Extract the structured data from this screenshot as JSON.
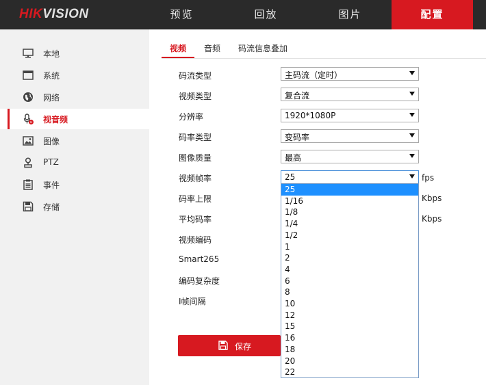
{
  "brand": {
    "logo_red": "HIK",
    "logo_rest": "VISION"
  },
  "nav": {
    "tabs": [
      {
        "label": "预览"
      },
      {
        "label": "回放"
      },
      {
        "label": "图片"
      },
      {
        "label": "配置",
        "active": true
      }
    ]
  },
  "sidebar": {
    "items": [
      {
        "label": "本地",
        "icon": "monitor-icon"
      },
      {
        "label": "系统",
        "icon": "window-icon"
      },
      {
        "label": "网络",
        "icon": "globe-icon"
      },
      {
        "label": "视音频",
        "icon": "mic-icon",
        "active": true
      },
      {
        "label": "图像",
        "icon": "image-icon"
      },
      {
        "label": "PTZ",
        "icon": "ptz-icon"
      },
      {
        "label": "事件",
        "icon": "event-list-icon"
      },
      {
        "label": "存储",
        "icon": "floppy-icon"
      }
    ]
  },
  "subtabs": [
    {
      "label": "视频",
      "active": true
    },
    {
      "label": "音频"
    },
    {
      "label": "码流信息叠加"
    }
  ],
  "form": {
    "stream_type": {
      "label": "码流类型",
      "value": "主码流（定时）"
    },
    "video_type": {
      "label": "视频类型",
      "value": "复合流"
    },
    "resolution": {
      "label": "分辨率",
      "value": "1920*1080P"
    },
    "bitrate_type": {
      "label": "码率类型",
      "value": "变码率"
    },
    "image_quality": {
      "label": "图像质量",
      "value": "最高"
    },
    "frame_rate": {
      "label": "视频帧率",
      "value": "25",
      "unit": "fps"
    },
    "max_bitrate": {
      "label": "码率上限",
      "unit": "Kbps"
    },
    "avg_bitrate": {
      "label": "平均码率",
      "unit": "Kbps"
    },
    "video_encoding": {
      "label": "视频编码"
    },
    "smart265": {
      "label": "Smart265"
    },
    "encoding_complexity": {
      "label": "编码复杂度"
    },
    "i_frame_interval": {
      "label": "I帧间隔"
    }
  },
  "frame_rate_options": [
    "25",
    "1/16",
    "1/8",
    "1/4",
    "1/2",
    "1",
    "2",
    "4",
    "6",
    "8",
    "10",
    "12",
    "15",
    "16",
    "18",
    "20",
    "22"
  ],
  "frame_rate_selected": "25",
  "save_label": "保存",
  "colors": {
    "accent": "#d71920",
    "topbar": "#2a2a2a",
    "sidebar": "#f1f1f1",
    "highlight": "#1e90ff"
  }
}
